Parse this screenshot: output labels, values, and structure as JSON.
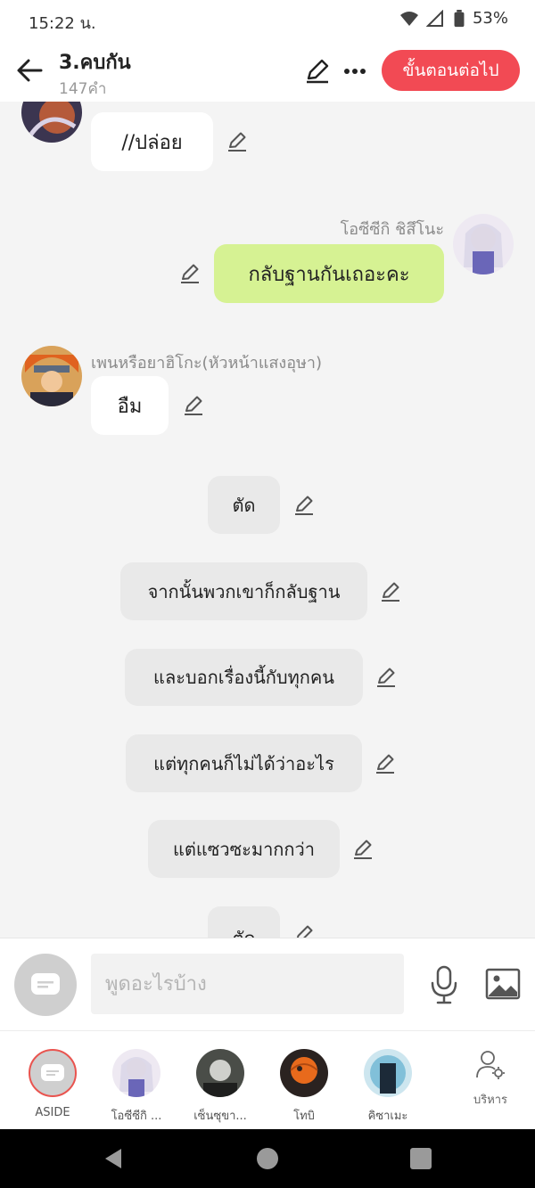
{
  "status_bar": {
    "time": "15:22 น.",
    "battery": "53%"
  },
  "header": {
    "title": "3.คบกัน",
    "subtitle": "147คำ",
    "next_label": "ขั้นตอนต่อไป"
  },
  "messages": [
    {
      "text": "//ปล่อย"
    },
    {
      "sender": "โอซีซีกิ ชิสึโนะ",
      "text": "กลับฐานกันเถอะคะ"
    },
    {
      "sender": "เพนหรือยาฮิโกะ(หัวหน้าแสงอุษา)",
      "text": "อืม"
    },
    {
      "text": "ตัด"
    },
    {
      "text": "จากนั้นพวกเขาก็กลับฐาน"
    },
    {
      "text": "และบอกเรื่องนี้กับทุกคน"
    },
    {
      "text": "แต่ทุกคนก็ไม่ได้ว่าอะไร"
    },
    {
      "text": "แต่แซวซะมากกว่า"
    },
    {
      "text": "ตัด"
    }
  ],
  "input": {
    "placeholder": "พูดอะไรบ้าง"
  },
  "characters": [
    {
      "label": "ASIDE"
    },
    {
      "label": "โอซีซีกิ ..."
    },
    {
      "label": "เซ็นซุขา..."
    },
    {
      "label": "โทบิ"
    },
    {
      "label": "คิซาเมะ"
    }
  ],
  "manage_label": "บริหาร",
  "colors": {
    "accent": "#f24a54",
    "bubble_green": "#d6f293",
    "bubble_gray": "#e9e9e9"
  },
  "icons": [
    "wifi-icon",
    "signal-icon",
    "battery-icon",
    "back-arrow-icon",
    "pencil-icon",
    "more-icon",
    "mic-icon",
    "image-icon",
    "manage-icon",
    "chat-bubble-icon"
  ]
}
